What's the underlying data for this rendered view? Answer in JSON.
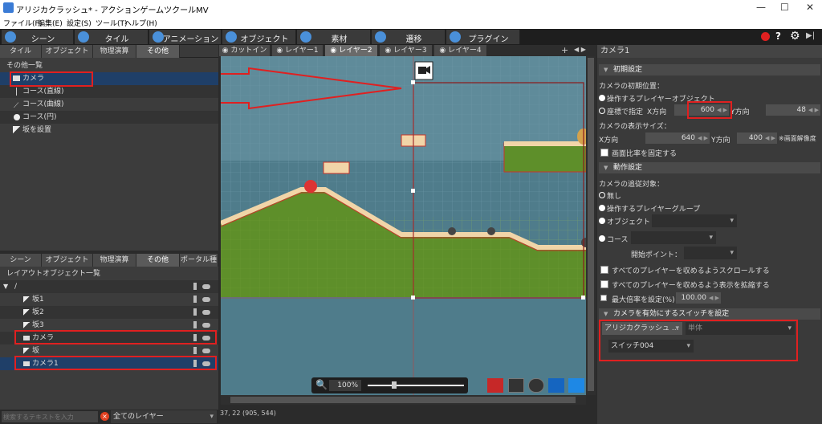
{
  "window": {
    "title": "アリジカクラッシュ* - アクションゲームツクールMV",
    "min": "—",
    "max": "☐",
    "close": "✕"
  },
  "menu": [
    "ファイル(F)",
    "編集(E)",
    "設定(S)",
    "ツール(T)",
    "ヘルプ(H)"
  ],
  "toolbar": [
    "シーン",
    "タイル",
    "アニメーション",
    "オブジェクト",
    "素材",
    "遷移",
    "プラグイン"
  ],
  "left_tabs": [
    "タイル",
    "オブジェクト",
    "物理演算",
    "その他"
  ],
  "other_list_title": "その他一覧",
  "other_items": [
    "カメラ",
    "コース(直線)",
    "コース(曲線)",
    "コース(円)",
    "坂を設置"
  ],
  "bottom_tabs": [
    "シーン",
    "オブジェクト",
    "物理演算",
    "その他",
    "ポータル種"
  ],
  "layout_title": "レイアウトオブジェクト一覧",
  "tree_root": "/",
  "tree_items": [
    "坂1",
    "坂2",
    "坂3",
    "カメラ",
    "坂",
    "カメラ1"
  ],
  "search": {
    "placeholder": "検索するテキストを入力",
    "layer": "全てのレイヤー"
  },
  "layer_tabs": [
    "カットイン",
    "レイヤー1",
    "レイヤー2",
    "レイヤー3",
    "レイヤー4"
  ],
  "zoom": "100%",
  "status": "37, 22 (905, 544)",
  "right": {
    "title": "カメラ1",
    "sec_init": "初期設定",
    "cam_pos": "カメラの初期位置：",
    "opt_player": "操作するプレイヤーオブジェクト",
    "opt_coord": "座標で指定",
    "xdir": "X方向",
    "ydir": "Y方向",
    "x_val": "600",
    "y_val": "48",
    "disp_size": "カメラの表示サイズ：",
    "w_val": "640",
    "h_val": "400",
    "res": "※画面解像度",
    "fix_ratio": "画面比率を固定する",
    "sec_action": "動作設定",
    "follow": "カメラの追従対象：",
    "f_none": "無し",
    "f_group": "操作するプレイヤーグループ",
    "f_obj": "オブジェクト",
    "f_course": "コース",
    "start_point": "開始ポイント：",
    "scroll_all": "すべてのプレイヤーを収めるようスクロールする",
    "zoom_all": "すべてのプレイヤーを収めるよう表示を拡縮する",
    "max_zoom": "最大倍率を設定(%)",
    "max_zoom_val": "100.00",
    "sec_switch": "カメラを有効にするスイッチを設定",
    "sw_project": "アリジカクラッシュ ...",
    "sw_type": "単体",
    "sw_name": "スイッチ004"
  }
}
